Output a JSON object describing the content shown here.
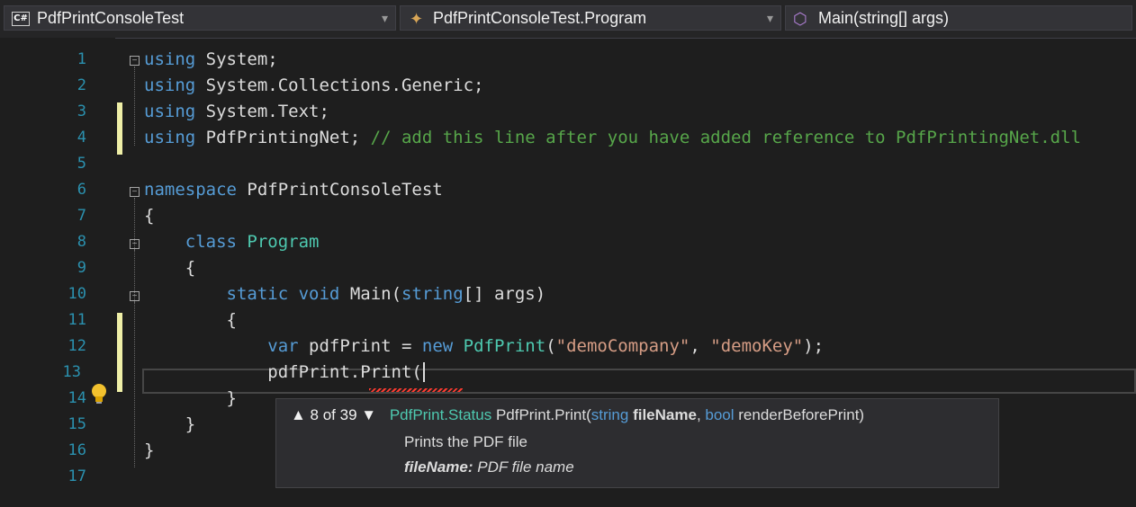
{
  "navbar": {
    "project": "PdfPrintConsoleTest",
    "type_name": "PdfPrintConsoleTest.Program",
    "member": "Main(string[] args)",
    "project_icon": "csharp-project-icon",
    "type_icon": "class-icon",
    "member_icon": "method-icon"
  },
  "editor": {
    "line_numbers": [
      "1",
      "2",
      "3",
      "4",
      "5",
      "6",
      "7",
      "8",
      "9",
      "10",
      "11",
      "12",
      "13",
      "14",
      "15",
      "16",
      "17"
    ],
    "lines": {
      "l1_kw": "using",
      "l1_rest": " System;",
      "l2_kw": "using",
      "l2_rest": " System.Collections.Generic;",
      "l3_kw": "using",
      "l3_rest": " System.Text;",
      "l4_kw": "using",
      "l4_rest": " PdfPrintingNet; ",
      "l4_cmt": "// add this line after you have added reference to PdfPrintingNet.dll",
      "l6_kw": "namespace",
      "l6_rest": " PdfPrintConsoleTest",
      "l7": "{",
      "l8_indent": "    ",
      "l8_kw": "class",
      "l8_sp": " ",
      "l8_cls": "Program",
      "l9": "    {",
      "l10_indent": "        ",
      "l10_kw1": "static",
      "l10_sp": " ",
      "l10_kw2": "void",
      "l10_rest1": " Main(",
      "l10_kw3": "string",
      "l10_rest2": "[] args)",
      "l11": "        {",
      "l12_indent": "            ",
      "l12_kw1": "var",
      "l12_rest1": " pdfPrint = ",
      "l12_kw2": "new",
      "l12_sp": " ",
      "l12_cls": "PdfPrint",
      "l12_p1": "(",
      "l12_s1": "\"demoCompany\"",
      "l12_comma": ", ",
      "l12_s2": "\"demoKey\"",
      "l12_end": ");",
      "l13": "            pdfPrint.Print(",
      "l14": "        }",
      "l15": "    }",
      "l16": "}"
    }
  },
  "tooltip": {
    "counter": "▲ 8 of 39 ▼",
    "ret_type": "PdfPrint.Status",
    "method": " PdfPrint.Print(",
    "p1_type": "string",
    "p1_name": " fileName",
    "sep": ", ",
    "p2_type": "bool",
    "p2_name": " renderBeforePrint)",
    "description": "Prints the PDF file",
    "param_name": "fileName:",
    "param_desc": " PDF file name"
  }
}
